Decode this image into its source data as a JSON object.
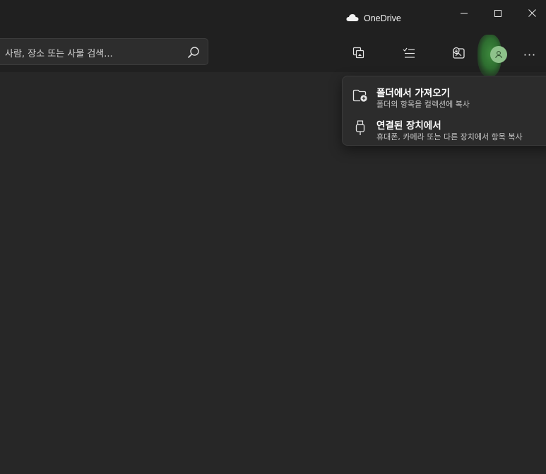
{
  "titlebar": {
    "onedrive_label": "OneDrive",
    "icons": [
      "cloud-icon",
      "minimize-icon",
      "maximize-icon",
      "close-icon"
    ]
  },
  "search": {
    "placeholder": "사람, 장소 또는 사물 검색..."
  },
  "toolbar": {
    "icons": [
      "slideshow-icon",
      "select-icon",
      "import-icon",
      "account-avatar",
      "more-icon"
    ],
    "more_label": "···"
  },
  "import_menu": {
    "items": [
      {
        "title": "폴더에서 가져오기",
        "subtitle": "폴더의 항목을 컬렉션에 복사",
        "icon": "folder-add-icon"
      },
      {
        "title": "연결된 장치에서",
        "subtitle": "휴대폰, 카메라 또는 다른 장치에서 항목 복사",
        "icon": "usb-device-icon"
      }
    ]
  },
  "colors": {
    "background": "#272727",
    "chrome": "#202020",
    "menu": "#2c2c2c",
    "avatar": "#8ec28b",
    "glow": "#3d8a3d"
  }
}
